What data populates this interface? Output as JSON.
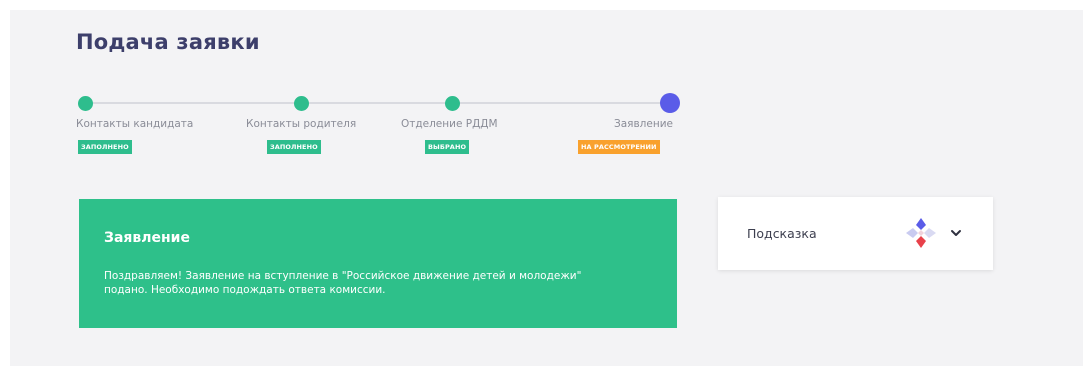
{
  "page": {
    "title": "Подача заявки"
  },
  "stepper": {
    "steps": [
      {
        "label": "Контакты кандидата",
        "status": "ЗАПОЛНЕНО",
        "state": "done"
      },
      {
        "label": "Контакты родителя",
        "status": "ЗАПОЛНЕНО",
        "state": "done"
      },
      {
        "label": "Отделение РДДМ",
        "status": "ВЫБРАНО",
        "state": "done"
      },
      {
        "label": "Заявление",
        "status": "НА РАССМОТРЕНИИ",
        "state": "current"
      }
    ]
  },
  "application_card": {
    "title": "Заявление",
    "message": "Поздравляем! Заявление на вступление в \"Российское движение детей и молодежи\" подано. Необходимо подождать ответа комиссии."
  },
  "hint": {
    "label": "Подсказка",
    "icon": "chevron-down-icon"
  },
  "colors": {
    "accent_green": "#2ec08a",
    "step_current": "#5a5ce8",
    "badge_orange": "#f9a12d",
    "title": "#3d3f6b"
  }
}
